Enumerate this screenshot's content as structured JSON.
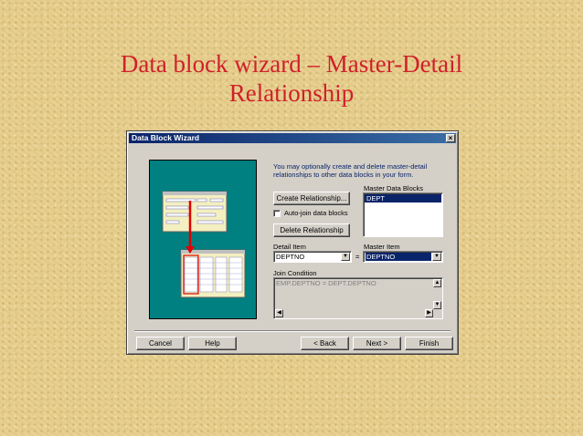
{
  "slide": {
    "title_line1": "Data block wizard – Master-Detail",
    "title_line2": "Relationship"
  },
  "dialog": {
    "title": "Data Block Wizard",
    "close_glyph": "×",
    "intro_line1": "You may optionally create and delete master-detail",
    "intro_line2": "relationships to other data blocks in your form.",
    "create_relationship_label": "Create Relationship...",
    "auto_join_label": "Auto-join data blocks",
    "auto_join_checked": false,
    "delete_relationship_label": "Delete Relationship",
    "master_blocks_label": "Master Data Blocks",
    "master_blocks_items": [
      "DEPT"
    ],
    "detail_item_label": "Detail Item",
    "detail_item_value": "DEPTNO",
    "equals_sign": "=",
    "master_item_label": "Master Item",
    "master_item_value": "DEPTNO",
    "join_condition_label": "Join Condition",
    "join_condition_value": "EMP.DEPTNO = DEPT.DEPTNO",
    "cancel_label": "Cancel",
    "help_label": "Help",
    "back_label": "< Back",
    "next_label": "Next >",
    "finish_label": "Finish"
  },
  "colors": {
    "title_red": "#d0202a",
    "titlebar_navy": "#0a246a",
    "illustration_teal": "#008080",
    "selection_navy": "#0a246a",
    "arrow_red": "#e00000"
  }
}
